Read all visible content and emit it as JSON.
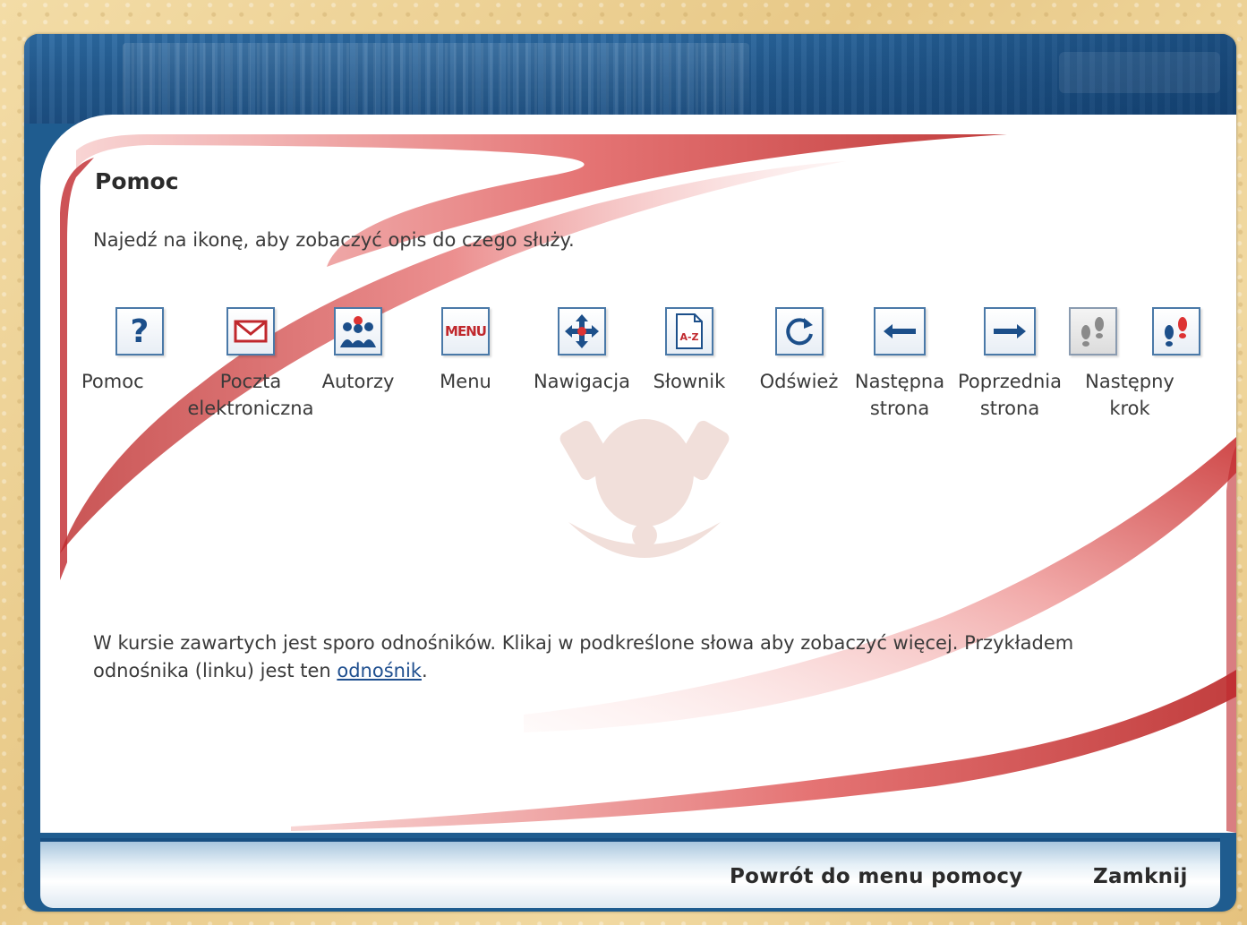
{
  "page": {
    "title": "Pomoc",
    "intro": "Najedź na ikonę, aby zobaczyć opis do czego służy."
  },
  "icons": [
    {
      "label": "Pomoc",
      "icon": "question-mark-icon"
    },
    {
      "label": "Poczta\nelektroniczna",
      "icon": "envelope-icon"
    },
    {
      "label": "Autorzy",
      "icon": "people-group-icon"
    },
    {
      "label": "Menu",
      "icon": "menu-icon",
      "text": "MENU"
    },
    {
      "label": "Nawigacja",
      "icon": "move-arrows-icon"
    },
    {
      "label": "Słownik",
      "icon": "dictionary-icon",
      "text": "A-Z"
    },
    {
      "label": "Odśwież",
      "icon": "refresh-icon"
    },
    {
      "label": "Następna\nstrona",
      "icon": "arrow-left-icon"
    },
    {
      "label": "Poprzednia\nstrona",
      "icon": "arrow-right-icon"
    },
    {
      "label": "Następny\nkrok",
      "icon": "footsteps-icons"
    }
  ],
  "note": {
    "text_before": "W kursie zawartych jest sporo odnośników. Klikaj w podkreślone słowa aby zobaczyć więcej. Przykładem odnośnika (linku) jest ten ",
    "link_text": "odnośnik",
    "text_after": "."
  },
  "footer": {
    "back_label": "Powrót do menu pomocy",
    "close_label": "Zamknij"
  },
  "colors": {
    "frame_blue": "#1f5c8f",
    "accent_red": "#c0282d",
    "link_blue": "#1f4f8f"
  }
}
